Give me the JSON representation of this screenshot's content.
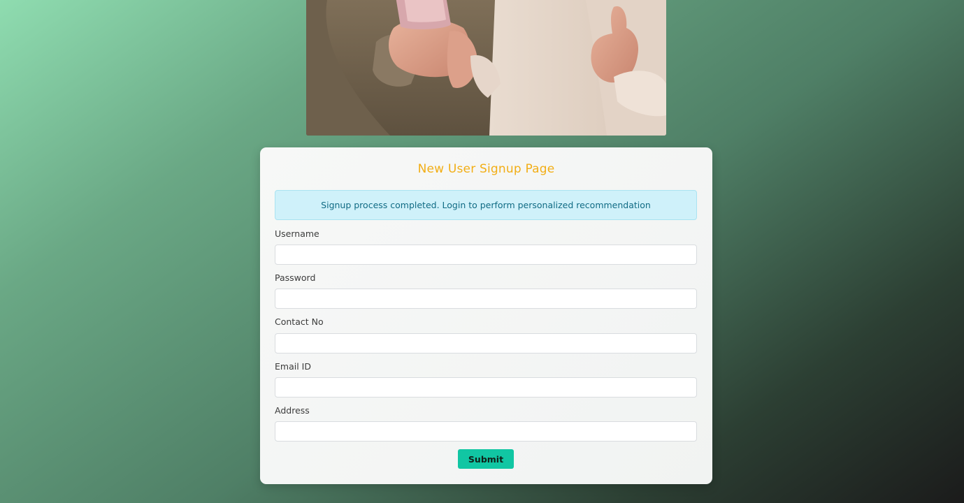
{
  "hero": {
    "image_name": "hero-photo-people-with-phone"
  },
  "form": {
    "title": "New User Signup Page",
    "alert_message": "Signup process completed. Login to perform personalized recommendation",
    "fields": [
      {
        "label": "Username",
        "value": ""
      },
      {
        "label": "Password",
        "value": ""
      },
      {
        "label": "Contact No",
        "value": ""
      },
      {
        "label": "Email ID",
        "value": ""
      },
      {
        "label": "Address",
        "value": ""
      }
    ],
    "submit_label": "Submit"
  },
  "colors": {
    "title": "#f2ae16",
    "alert_bg": "#cff1fa",
    "alert_text": "#106b84",
    "submit_bg": "#11c6a3"
  }
}
